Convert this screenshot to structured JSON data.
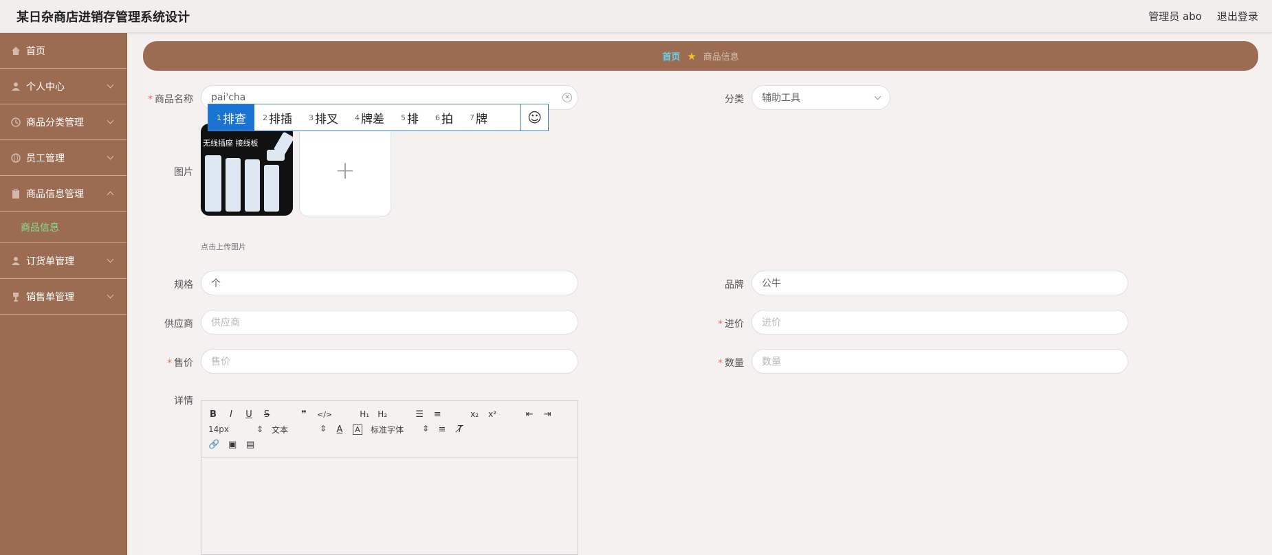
{
  "app": {
    "title": "某日杂商店进销存管理系统设计"
  },
  "header": {
    "user": "管理员 abo",
    "logout": "退出登录"
  },
  "sidebar": {
    "items": [
      {
        "label": "首页"
      },
      {
        "label": "个人中心"
      },
      {
        "label": "商品分类管理"
      },
      {
        "label": "员工管理"
      },
      {
        "label": "商品信息管理",
        "sub": "商品信息"
      },
      {
        "label": "订货单管理"
      },
      {
        "label": "销售单管理"
      }
    ]
  },
  "breadcrumb": {
    "home": "首页",
    "current": "商品信息"
  },
  "form": {
    "name_label": "商品名称",
    "name_value": "pai'cha",
    "category_label": "分类",
    "category_value": "辅助工具",
    "image_label": "图片",
    "image_caption_1": "无线插座 接线板",
    "upload_tip": "点击上传图片",
    "spec_label": "规格",
    "spec_value": "个",
    "brand_label": "品牌",
    "brand_value": "公牛",
    "supplier_label": "供应商",
    "supplier_placeholder": "供应商",
    "cost_label": "进价",
    "cost_placeholder": "进价",
    "price_label": "售价",
    "price_placeholder": "售价",
    "qty_label": "数量",
    "qty_placeholder": "数量",
    "detail_label": "详情"
  },
  "ime": {
    "candidates": [
      {
        "num": "1",
        "text": "排查"
      },
      {
        "num": "2",
        "text": "排插"
      },
      {
        "num": "3",
        "text": "排叉"
      },
      {
        "num": "4",
        "text": "牌差"
      },
      {
        "num": "5",
        "text": "排"
      },
      {
        "num": "6",
        "text": "拍"
      },
      {
        "num": "7",
        "text": "牌"
      }
    ]
  },
  "editor": {
    "font_size": "14px",
    "block": "文本",
    "font_family": "标准字体"
  },
  "colors": {
    "sidebar": "#9b6c52",
    "accent_blue": "#1a73d1",
    "sub_active": "#7fe08a"
  }
}
